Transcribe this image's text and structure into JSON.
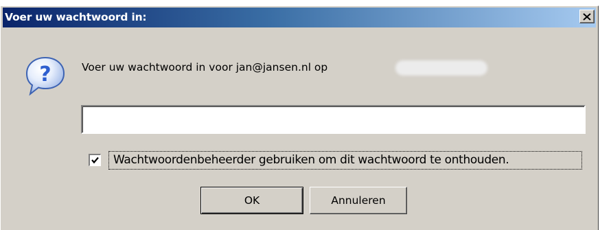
{
  "dialog": {
    "title": "Voer uw wachtwoord in:",
    "close_symbol": "×",
    "icon": "question-icon",
    "message": "Voer uw wachtwoord in voor jan@jansen.nl op",
    "password_value": "",
    "remember_checked": true,
    "remember_label": "Wachtwoordenbeheerder gebruiken om dit wachtwoord te onthouden.",
    "ok_label": "OK",
    "cancel_label": "Annuleren"
  },
  "colors": {
    "title_gradient_start": "#0a246a",
    "title_gradient_end": "#a6caf0",
    "face": "#d4d0c8",
    "icon_blue": "#2f6fd6"
  }
}
